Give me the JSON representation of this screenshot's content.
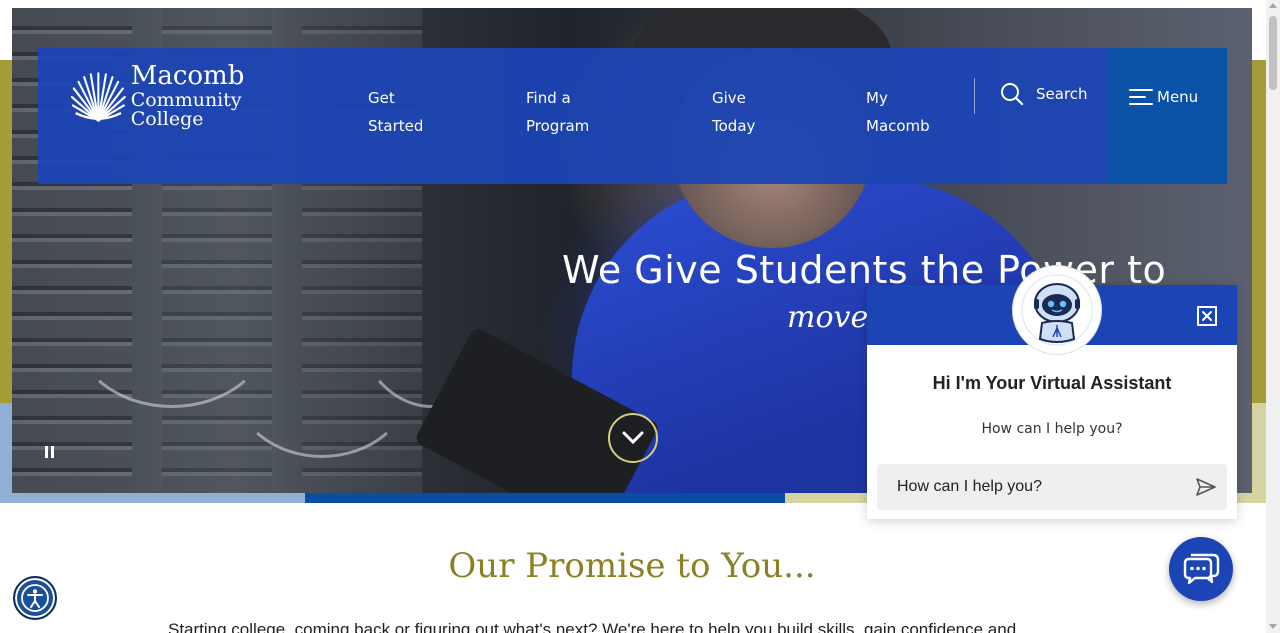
{
  "colors": {
    "header_blue": "#1c45b4",
    "menu_blue": "#0a52a8",
    "olive": "#a59c37",
    "promise_title": "#8a8024",
    "chat_blue": "#1b45b4"
  },
  "header": {
    "logo": {
      "line1": "Macomb",
      "line2": "Community College",
      "icon": "shell-logo-icon"
    },
    "nav": [
      {
        "line1": "Get",
        "line2": "Started"
      },
      {
        "line1": "Find a",
        "line2": "Program"
      },
      {
        "line1": "Give",
        "line2": "Today"
      },
      {
        "line1": "My",
        "line2": "Macomb"
      }
    ],
    "search_label": "Search",
    "search_icon": "search-icon",
    "menu_label": "Menu",
    "menu_icon": "hamburger-icon"
  },
  "hero": {
    "headline": "We Give Students the Power to",
    "script": "move forward",
    "pause_icon": "pause-icon",
    "scroll_icon": "chevron-down-icon"
  },
  "promise": {
    "title": "Our Promise to You...",
    "body": "Starting college, coming back or figuring out what's next? We're here to help you build skills, gain confidence and"
  },
  "chat": {
    "title": "Hi I'm Your Virtual Assistant",
    "subtitle": "How can I help you?",
    "input_placeholder": "How can I help you?",
    "close_icon": "close-icon",
    "send_icon": "send-icon",
    "avatar_icon": "robot-avatar-icon",
    "launcher_icon": "chat-bubbles-icon"
  },
  "accessibility": {
    "icon": "accessibility-icon"
  }
}
